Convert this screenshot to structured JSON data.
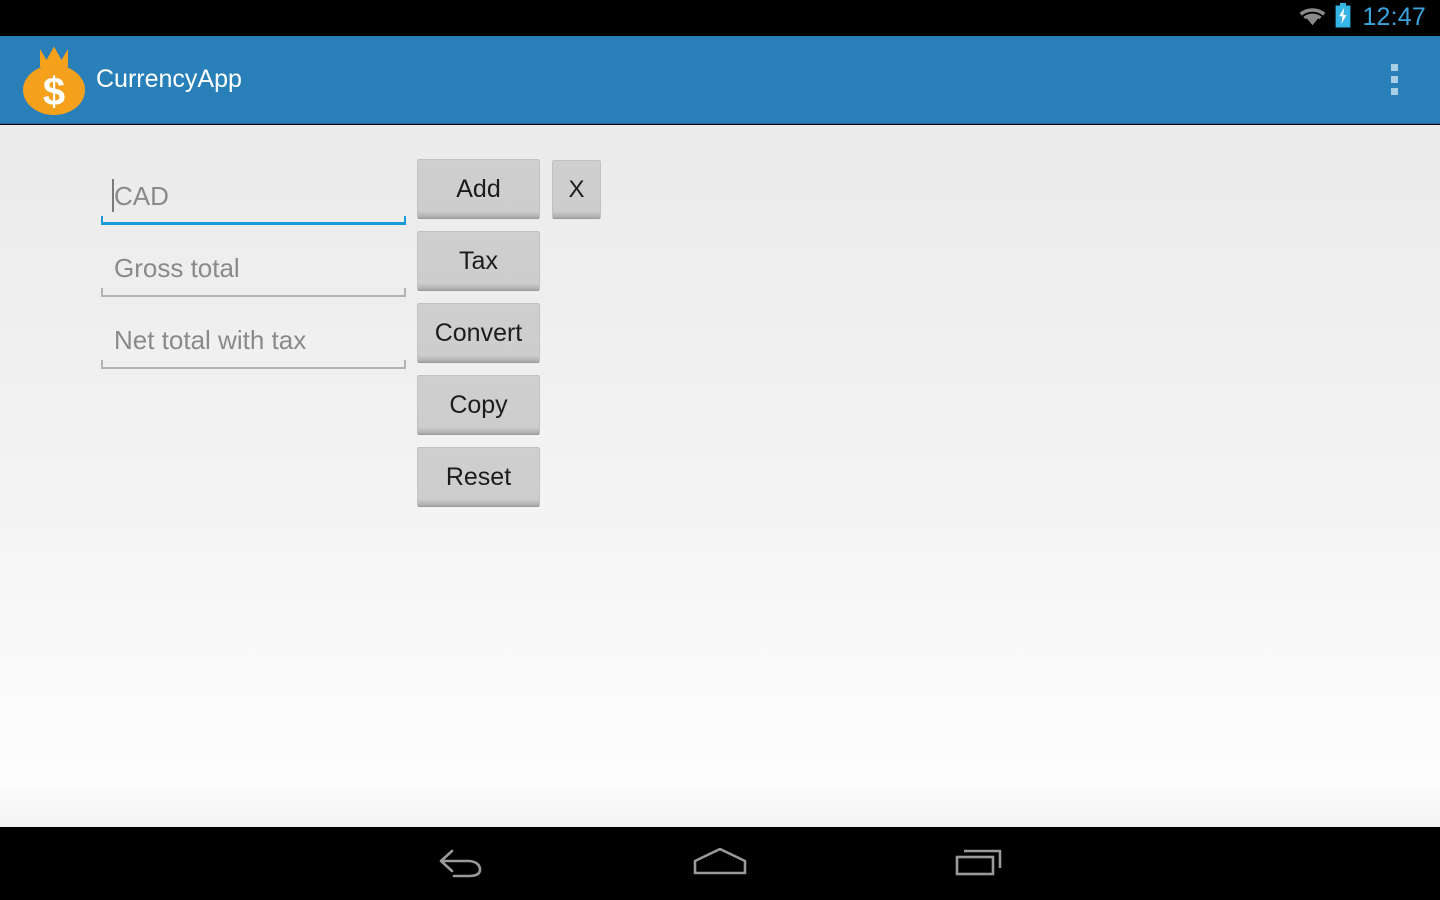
{
  "status_bar": {
    "clock": "12:47",
    "wifi_icon": "wifi-icon",
    "battery_icon": "battery-charging-icon",
    "clock_color": "#3aa3dc"
  },
  "action_bar": {
    "title": "CurrencyApp",
    "app_icon": "money-bag-icon",
    "overflow_icon": "overflow-menu-icon",
    "background_color": "#2980b9",
    "title_color": "#ffffff",
    "icon_color": "#f5a11b"
  },
  "form": {
    "fields": [
      {
        "name": "currency-code-input",
        "placeholder": "CAD",
        "value": "",
        "focused": true
      },
      {
        "name": "gross-total-input",
        "placeholder": "Gross total",
        "value": "",
        "focused": false
      },
      {
        "name": "net-total-input",
        "placeholder": "Net total with tax",
        "value": "",
        "focused": false
      }
    ],
    "buttons": [
      {
        "name": "add-button",
        "label": "Add"
      },
      {
        "name": "tax-button",
        "label": "Tax"
      },
      {
        "name": "convert-button",
        "label": "Convert"
      },
      {
        "name": "copy-button",
        "label": "Copy"
      },
      {
        "name": "reset-button",
        "label": "Reset"
      }
    ],
    "clear_button": {
      "name": "clear-button",
      "label": "X"
    },
    "focus_color": "#1a9ad7",
    "placeholder_color": "#8a8a8a"
  },
  "nav_bar": {
    "back_label": "Back",
    "home_label": "Home",
    "recents_label": "Recent apps",
    "background_color": "#000000",
    "icon_color": "#9a9a9a"
  }
}
